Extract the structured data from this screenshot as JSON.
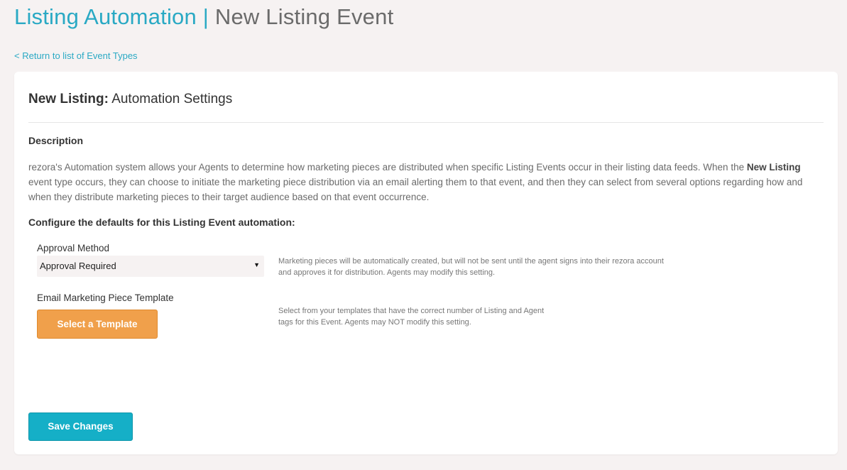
{
  "header": {
    "app_title": "Listing Automation",
    "separator": "|",
    "page_title": "New Listing Event"
  },
  "back_link": "< Return to list of Event Types",
  "card": {
    "title_strong": "New Listing:",
    "title_rest": "Automation Settings",
    "description_heading": "Description",
    "description": {
      "part1": "rezora's Automation system allows your Agents to determine how marketing pieces are distributed when specific Listing Events occur in their listing data feeds. When the ",
      "bold": "New Listing",
      "part2": " event type occurs, they can choose to initiate the marketing piece distribution via an email alerting them to that event, and then they can select from several options regarding how and when they distribute marketing pieces to their target audience based on that event occurrence."
    },
    "config_heading": "Configure the defaults for this Listing Event automation:",
    "approval": {
      "label": "Approval Method",
      "selected": "Approval Required",
      "help": "Marketing pieces will be automatically created, but will not be sent until the agent signs into their rezora account and approves it for distribution. Agents may modify this setting."
    },
    "template": {
      "label": "Email Marketing Piece Template",
      "button": "Select a Template",
      "help": "Select from your templates that have the correct number of Listing and Agent tags for this Event. Agents may NOT modify this setting."
    },
    "save_button": "Save Changes"
  },
  "colors": {
    "accent": "#2aa9c4",
    "template_button": "#f0a04b",
    "save_button": "#15afc7",
    "background": "#f6f2f2"
  },
  "icons": {
    "select_caret": "caret-down-icon"
  }
}
